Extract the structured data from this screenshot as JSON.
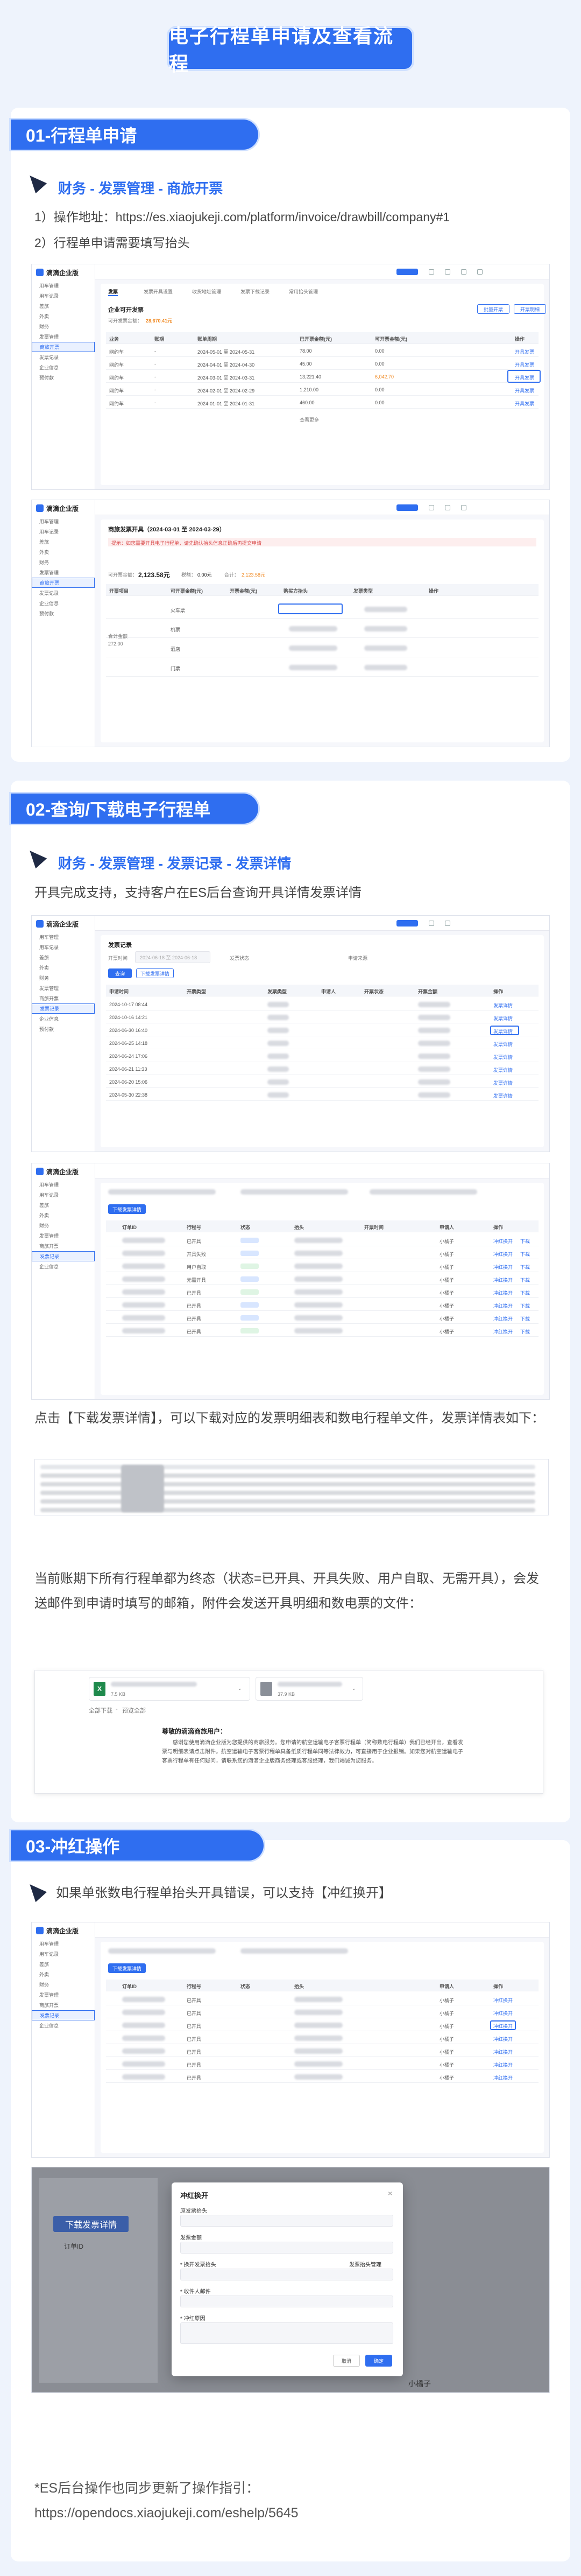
{
  "page_title": "电子行程单申请及查看流程",
  "sec1": {
    "heading": "01-行程单申请",
    "path": "财务 - 发票管理 - 商旅开票",
    "step1": "1）操作地址：https://es.xiaojukeji.com/platform/invoice/drawbill/company#1",
    "step2": "2）行程单申请需要填写抬头"
  },
  "sec2": {
    "heading": "02-查询/下载电子行程单",
    "path": "财务 - 发票管理 - 发票记录 - 发票详情",
    "desc1": "开具完成支持，支持客户在ES后台查询开具详情发票详情",
    "desc2": "点击【下载发票详情】，可以下载对应的发票明细表和数电行程单文件，发票详情表如下：",
    "desc3": "当前账期下所有行程单都为终态（状态=已开具、开具失败、用户自取、无需开具），会发送邮件到申请时填写的邮箱，附件会发送开具明细和数电票的文件："
  },
  "sec3": {
    "heading": "03-冲红操作",
    "desc": "如果单张数电行程单抬头开具错误，可以支持【冲红换开】"
  },
  "footer": {
    "line1": "*ES后台操作也同步更新了操作指引：",
    "line2": "https://opendocs.xiaojukeji.com/eshelp/5645"
  },
  "mock": {
    "brand": "滴滴企业版",
    "sidebar": [
      "用车管理",
      "用车记录",
      "差旅",
      "外卖",
      "财务",
      "发票管理",
      "商旅开票",
      "发票记录",
      "企业信息",
      "预付款"
    ],
    "s1a": {
      "tabs": [
        "发票",
        "发票开具设置",
        "收货地址管理",
        "发票下载记录",
        "常用抬头管理"
      ],
      "panel_title": "企业可开发票",
      "amount_label": "可开发票金额：",
      "amount_value": "28,670.41元",
      "btn_apply": "批量开票",
      "btn_detail": "开票明细",
      "cols": [
        "业务",
        "账期",
        "账单周期",
        "已开票金额(元)",
        "可开票金额(元)",
        "操作"
      ],
      "rows": [
        [
          "网约车",
          "-",
          "2024-05-01 至 2024-05-31",
          "78.00",
          "0.00",
          "开具发票"
        ],
        [
          "网约车",
          "-",
          "2024-04-01 至 2024-04-30",
          "45.00",
          "0.00",
          "开具发票"
        ],
        [
          "网约车",
          "-",
          "2024-03-01 至 2024-03-31",
          "13,221.40",
          "6,042.70",
          "开具发票"
        ],
        [
          "网约车",
          "-",
          "2024-02-01 至 2024-02-29",
          "1,210.00",
          "0.00",
          "开具发票"
        ],
        [
          "网约车",
          "-",
          "2024-01-01 至 2024-01-31",
          "460.00",
          "0.00",
          "开具发票"
        ]
      ],
      "footer": "查看更多"
    },
    "s1b": {
      "title": "商旅发票开具（2024-03-01 至 2024-03-29）",
      "notice": "提示：如您需要开具电子行程单，请先确认抬头信息正确后再提交申请",
      "amount_label": "可开票金额：",
      "amount_value": "2,123.58元",
      "tax_label": "税额：",
      "tax_value": "0.00元",
      "total_label": "合计：",
      "total_value": "2,123.58元",
      "cols": [
        "开票项目",
        "可开票金额(元)",
        "开票金额(元)",
        "购买方抬头",
        "发票类型",
        "操作"
      ],
      "rows": [
        "火车票",
        "机票",
        "酒店",
        "门票"
      ],
      "side": "合计金额\n272.00"
    },
    "s2a": {
      "title": "发票记录",
      "filters": [
        "开票时间",
        "2024-06-18 至 2024-06-18",
        "发票状态",
        "申请来源"
      ],
      "btn_query": "查询",
      "btn_reset": "下载发票详情",
      "cols": [
        "申请时间",
        "开票类型",
        "发票类型",
        "申请人",
        "开票状态",
        "开票金额",
        "操作"
      ],
      "rows": [
        "2024-10-17 08:44",
        "2024-10-16 14:21",
        "2024-06-30 16:40",
        "2024-06-25 14:18",
        "2024-06-24 17:06",
        "2024-06-21 11:33",
        "2024-06-20 15:06",
        "2024-05-30 22:38"
      ],
      "op": "发票详情"
    },
    "s2b": {
      "btn": "下载发票详情",
      "cols": [
        "订单ID",
        "行程号",
        "状态",
        "抬头",
        "开票时间",
        "申请人",
        "操作"
      ],
      "status": [
        "已开具",
        "开具失败",
        "用户自取",
        "无需开具"
      ],
      "op": "冲红换开",
      "op2": "下载"
    },
    "att": {
      "file1_size": "7.5 KB",
      "file2_size": "37.9 KB",
      "download_all": "全部下载",
      "preview_all": "预览全部",
      "greeting": "尊敬的滴滴商旅用户：",
      "body": "感谢您使用滴滴企业版为您提供的商旅服务。您申请的航空运输电子客票行程单（简称数电行程单）我们已经开出，查看发票与明细表请点击附件。航空运输电子客票行程单具备纸质行程单同等法律效力，可直接用于企业报销。如果您对航空运输电子客票行程单有任何疑问，请联系您的滴滴企业版商务经理或客服经理，我们竭诚为您服务。"
    },
    "modal": {
      "title": "冲红换开",
      "f1": "原发票抬头",
      "f2": "发票金额",
      "f3": "* 换开发票抬头",
      "f3_link": "发票抬头管理",
      "f4": "* 收件人邮件",
      "f5": "* 冲红原因",
      "cancel": "取消",
      "ok": "确定",
      "bg_btn": "下载发票详情",
      "bg_col": "订单ID",
      "bg_user": "小橘子"
    }
  }
}
